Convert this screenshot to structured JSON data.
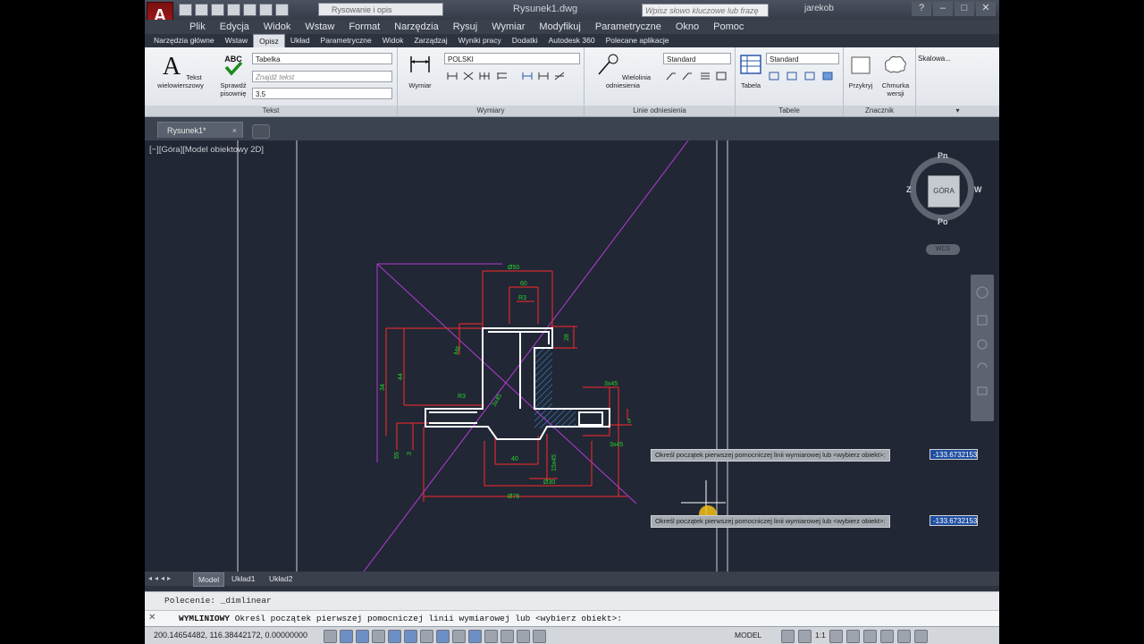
{
  "window": {
    "workspace": "Rysowanie i opis",
    "title": "Rysunek1.dwg",
    "search_placeholder": "Wpisz słowo kluczowe lub frazę",
    "user": "jarekob",
    "help": "?"
  },
  "menu": [
    "Plik",
    "Edycja",
    "Widok",
    "Wstaw",
    "Format",
    "Narzędzia",
    "Rysuj",
    "Wymiar",
    "Modyfikuj",
    "Parametryczne",
    "Okno",
    "Pomoc"
  ],
  "ribbon_tabs": {
    "items": [
      "Narzędzia główne",
      "Wstaw",
      "Opisz",
      "Układ",
      "Parametryczne",
      "Widok",
      "Zarządzaj",
      "Wyniki pracy",
      "Dodatki",
      "Autodesk 360",
      "Polecane aplikacje"
    ],
    "active": "Opisz"
  },
  "ribbon": {
    "text_panel": {
      "title": "Tekst",
      "mtext_label": "Tekst wielowierszowy",
      "spell_label": "Sprawdź pisownię",
      "style_value": "Tabelka",
      "find_placeholder": "Znajdź tekst",
      "height_value": "3.5"
    },
    "dim_panel": {
      "title": "Wymiary",
      "dim_label": "Wymiar",
      "style_value": "POLSKI"
    },
    "leader_panel": {
      "title": "Linie odniesienia",
      "leader_label": "Wielolinia odniesienia",
      "style_value": "Standard"
    },
    "table_panel": {
      "title": "Tabele",
      "table_label": "Tabela",
      "style_value": "Standard"
    },
    "markup_panel": {
      "title": "Znacznik",
      "wipeout_label": "Przykryj",
      "cloud_label": "Chmurka wersji"
    },
    "scale_panel": {
      "title": "Skalowa..."
    }
  },
  "file_tab": {
    "label": "Rysunek1*",
    "close": "×"
  },
  "viewport": {
    "label": "[−][Góra][Model obiektowy 2D]",
    "compass": {
      "north": "Pn",
      "south": "Po",
      "east": "W",
      "west": "Z",
      "cube": "GÓRA"
    },
    "ucs": "WCS",
    "prompt1": "Określ początek pierwszej pomocniczej linii wymiarowej lub <wybierz obiekt>:",
    "coord1": "-133.6732153",
    "prompt2": "Określ początek pierwszej pomocniczej linii wymiarowej lub <wybierz obiekt>:",
    "coord2": "-133.6732153"
  },
  "drawing_dims": [
    "R7",
    "Ø25",
    "Ø50",
    "Ø58",
    "60",
    "28",
    "R3",
    "3x45°",
    "M6",
    "3x45",
    "3x45",
    "40",
    "Ø30",
    "Ø76",
    "15x45",
    "55",
    "34",
    "44",
    "3x45",
    "3",
    "5"
  ],
  "layout_tabs": [
    "Model",
    "Układ1",
    "Układ2"
  ],
  "layout_active": "Model",
  "command": {
    "history": "Polecenie: _dimlinear",
    "current_cmd": "WYMLINIOWY",
    "current_prompt": "Określ początek pierwszej pomocniczej linii wymiarowej lub <wybierz obiekt>:"
  },
  "status": {
    "coordinates": "200.14654482, 116.38442172, 0.00000000",
    "space": "MODEL",
    "scale": "1:1"
  },
  "colors": {
    "canvas": "#212735",
    "geometry": "#ffffff",
    "dimension": "#ff2a2a",
    "dim_text": "#2bd12b",
    "construction": "#b43ad6",
    "hatch": "#3a8ad0"
  }
}
